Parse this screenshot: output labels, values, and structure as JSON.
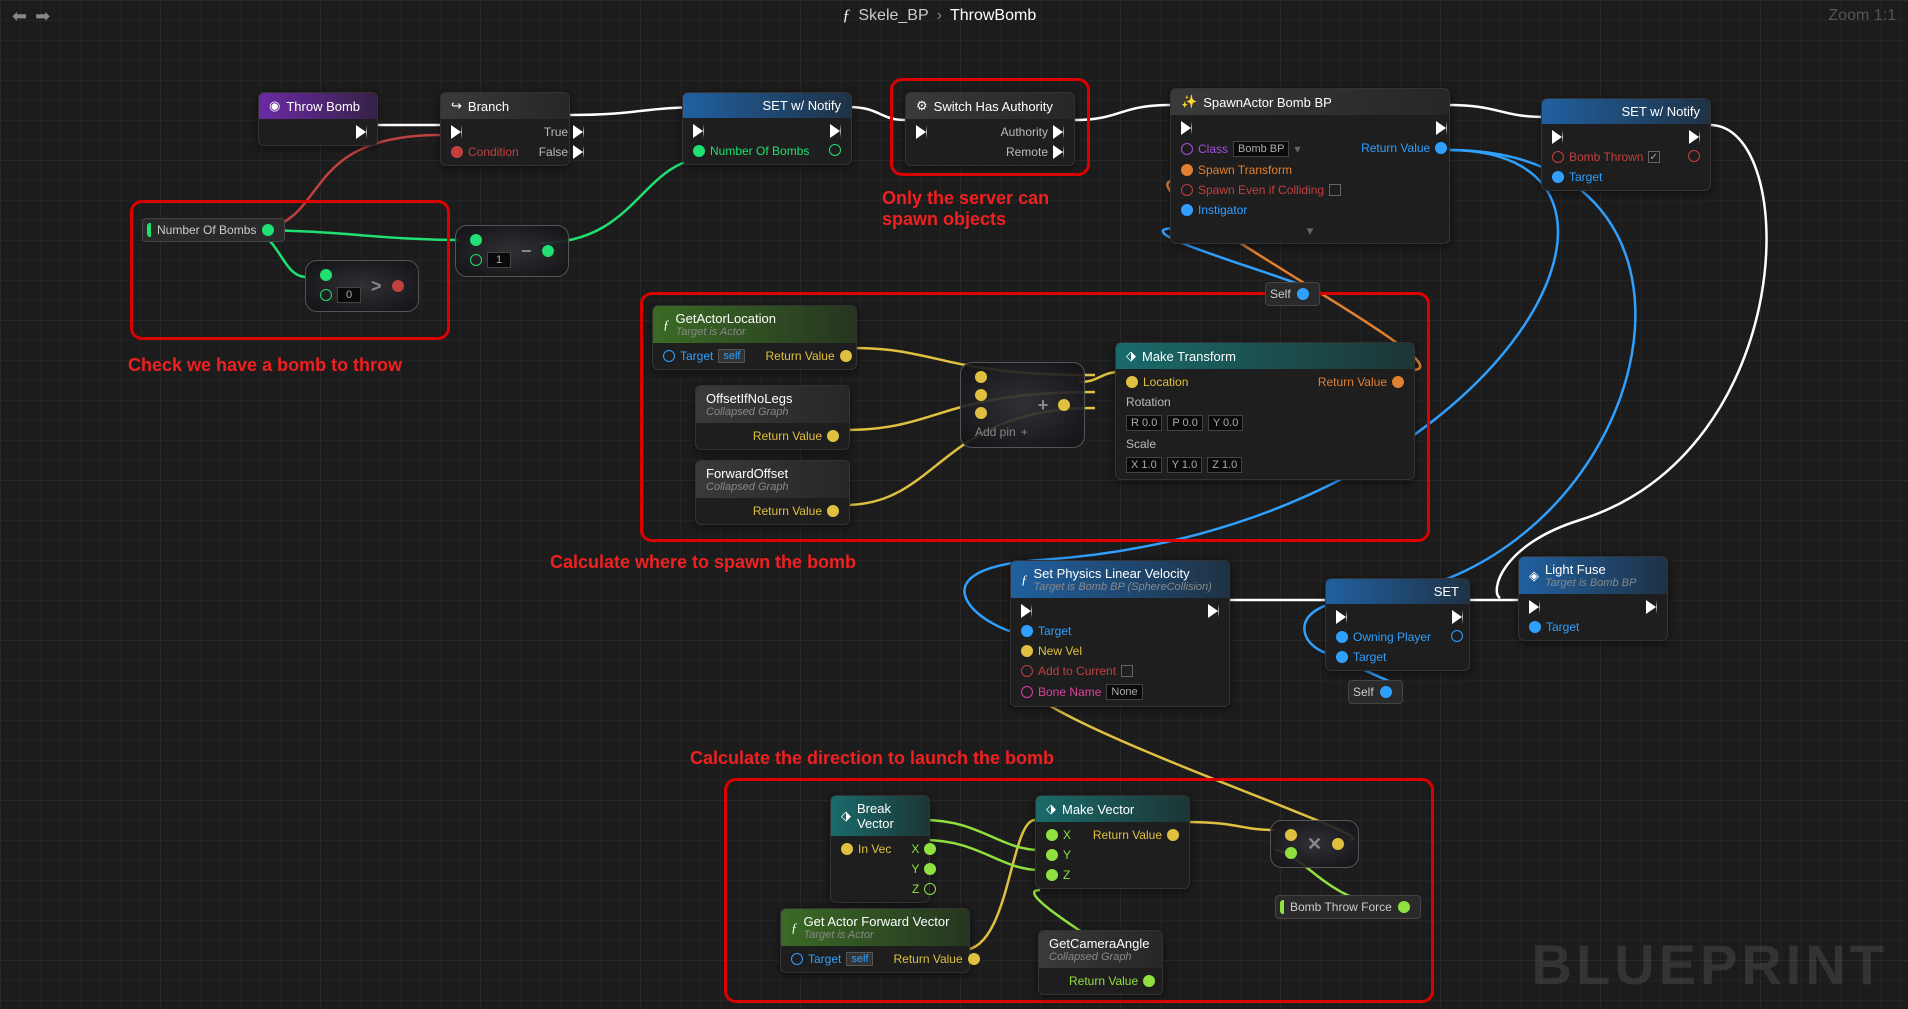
{
  "breadcrumb": {
    "parent": "Skele_BP",
    "func": "ThrowBomb"
  },
  "zoom": "Zoom 1:1",
  "watermark": "BLUEPRINT",
  "nodes": {
    "throwBomb": {
      "title": "Throw Bomb"
    },
    "branch": {
      "title": "Branch",
      "cond": "Condition",
      "t": "True",
      "f": "False"
    },
    "set1": {
      "title": "SET w/ Notify",
      "pin": "Number Of Bombs"
    },
    "switch": {
      "title": "Switch Has Authority",
      "a": "Authority",
      "r": "Remote"
    },
    "spawn": {
      "title": "SpawnActor Bomb BP",
      "cls": "Class",
      "clsVal": "Bomb BP",
      "st": "Spawn Transform",
      "sec": "Spawn Even if Colliding",
      "inst": "Instigator",
      "rv": "Return Value"
    },
    "set2": {
      "title": "SET w/ Notify",
      "pin": "Bomb Thrown",
      "tgt": "Target"
    },
    "numBombs": "Number Of Bombs",
    "gtZero": "0",
    "decOne": "1",
    "getLoc": {
      "title": "GetActorLocation",
      "sub": "Target is Actor",
      "tgt": "Target",
      "self": "self",
      "rv": "Return Value"
    },
    "offsetLegs": {
      "title": "OffsetIfNoLegs",
      "sub": "Collapsed Graph",
      "rv": "Return Value"
    },
    "fwdOffset": {
      "title": "ForwardOffset",
      "sub": "Collapsed Graph",
      "rv": "Return Value"
    },
    "addPin": "Add pin",
    "makeT": {
      "title": "Make Transform",
      "loc": "Location",
      "rot": "Rotation",
      "scale": "Scale",
      "rv": "Return Value",
      "r": "R",
      "p": "P",
      "y": "Y",
      "x": "X",
      "yy": "Y",
      "z": "Z",
      "v0": "0.0",
      "v1": "1.0"
    },
    "self": "Self",
    "setVel": {
      "title": "Set Physics Linear Velocity",
      "sub": "Target is Bomb BP (SphereCollision)",
      "tgt": "Target",
      "nv": "New Vel",
      "atc": "Add to Current",
      "bn": "Bone Name",
      "bnv": "None"
    },
    "set3": {
      "title": "SET",
      "op": "Owning Player",
      "tgt": "Target"
    },
    "lightFuse": {
      "title": "Light Fuse",
      "sub": "Target is Bomb BP",
      "tgt": "Target"
    },
    "self2": "Self",
    "breakV": {
      "title": "Break Vector",
      "iv": "In Vec",
      "x": "X",
      "y": "Y",
      "z": "Z"
    },
    "makeV": {
      "title": "Make Vector",
      "x": "X",
      "y": "Y",
      "z": "Z",
      "rv": "Return Value"
    },
    "getFwd": {
      "title": "Get Actor Forward Vector",
      "sub": "Target is Actor",
      "tgt": "Target",
      "self": "self",
      "rv": "Return Value"
    },
    "camAngle": {
      "title": "GetCameraAngle",
      "sub": "Collapsed Graph",
      "rv": "Return Value"
    },
    "bombForce": "Bomb Throw Force"
  },
  "annotations": {
    "a1": "Check we have a bomb to throw",
    "a2": "Only the server can spawn objects",
    "a3": "Calculate where to spawn the bomb",
    "a4": "Calculate the direction to launch the bomb"
  }
}
